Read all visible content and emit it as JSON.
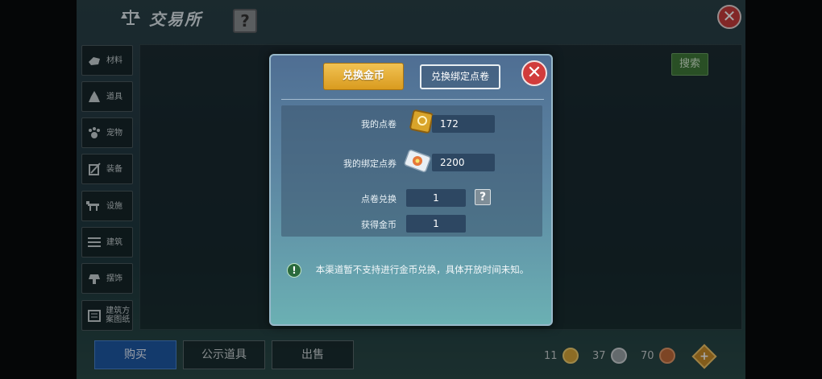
{
  "header": {
    "title": "交易所",
    "help": "?",
    "close": "✕"
  },
  "sidebar": {
    "items": [
      {
        "label": "材料",
        "icon": "materials-icon"
      },
      {
        "label": "道具",
        "icon": "items-icon"
      },
      {
        "label": "宠物",
        "icon": "pet-icon"
      },
      {
        "label": "装备",
        "icon": "equipment-icon"
      },
      {
        "label": "设施",
        "icon": "facility-icon"
      },
      {
        "label": "建筑",
        "icon": "building-icon"
      },
      {
        "label": "摆饰",
        "icon": "decoration-icon"
      },
      {
        "label": "建筑方案图纸",
        "icon": "blueprint-icon"
      }
    ]
  },
  "search": {
    "label": "搜索"
  },
  "bottom_tabs": [
    {
      "label": "购买",
      "active": true
    },
    {
      "label": "公示道具",
      "active": false
    },
    {
      "label": "出售",
      "active": false
    }
  ],
  "currencies": [
    {
      "value": "11",
      "color": "#d7a63a"
    },
    {
      "value": "37",
      "color": "#9aa3a8"
    },
    {
      "value": "70",
      "color": "#c06a3a"
    }
  ],
  "modal": {
    "tab_exchange_gold": "兑换金币",
    "tab_exchange_bound": "兑换绑定点卷",
    "close": "✕",
    "my_points_label": "我的点卷",
    "my_points_value": "172",
    "my_bound_label": "我的绑定点券",
    "my_bound_value": "2200",
    "exchange_label": "点卷兑换",
    "exchange_value": "1",
    "gain_label": "获得金币",
    "gain_value": "1",
    "help": "?",
    "notice_icon": "!",
    "notice": "本渠道暂不支持进行金币兑换，具体开放时间未知。"
  },
  "colors": {
    "accent_gold": "#e0a630",
    "active_tab": "#1e5aa6",
    "close_red": "#d13c3c"
  }
}
